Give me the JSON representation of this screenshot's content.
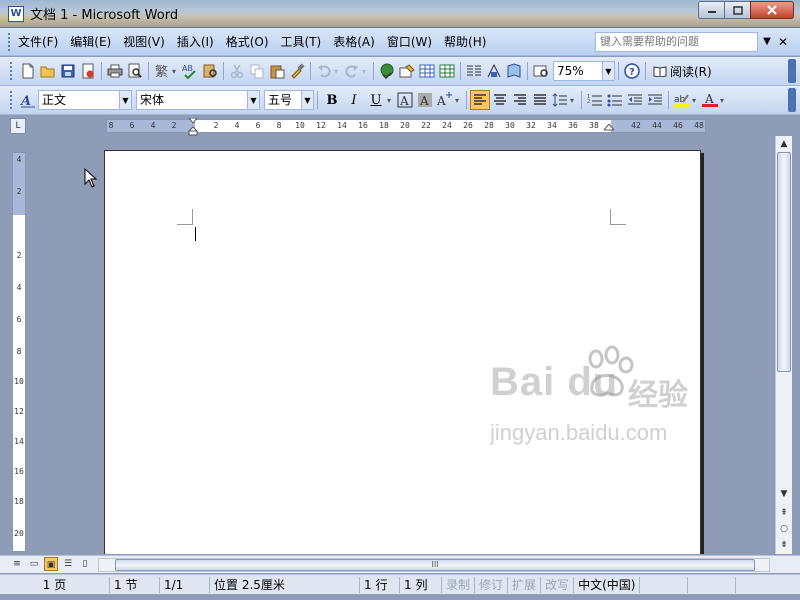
{
  "window": {
    "title": "文档 1 - Microsoft Word",
    "app_icon": "W",
    "min_icon": "minimize-icon",
    "max_icon": "maximize-icon",
    "close_icon": "close-icon"
  },
  "menubar": {
    "items": [
      {
        "label": "文件(F)"
      },
      {
        "label": "编辑(E)"
      },
      {
        "label": "视图(V)"
      },
      {
        "label": "插入(I)"
      },
      {
        "label": "格式(O)"
      },
      {
        "label": "工具(T)"
      },
      {
        "label": "表格(A)"
      },
      {
        "label": "窗口(W)"
      },
      {
        "label": "帮助(H)"
      }
    ],
    "help_placeholder": "键入需要帮助的问题"
  },
  "standard_toolbar": {
    "zoom": "75%",
    "read_label": "阅读(R)"
  },
  "format_toolbar": {
    "style": "正文",
    "font": "宋体",
    "size": "五号",
    "bold": "B",
    "italic": "I",
    "underline": "U"
  },
  "ruler": {
    "corner": "L",
    "h_ticks": [
      "8",
      "6",
      "4",
      "2",
      "2",
      "4",
      "6",
      "8",
      "10",
      "12",
      "14",
      "16",
      "18",
      "20",
      "22",
      "24",
      "26",
      "28",
      "30",
      "32",
      "34",
      "36",
      "38",
      "42",
      "44",
      "46",
      "48"
    ],
    "v_ticks": [
      "4",
      "2",
      "2",
      "4",
      "6",
      "8",
      "10",
      "12",
      "14",
      "16",
      "18",
      "20"
    ]
  },
  "watermark": {
    "logo": "Bai du",
    "cn": "经验",
    "url": "jingyan.baidu.com"
  },
  "hscroll": {
    "thumb_grip": "III"
  },
  "statusbar": {
    "page": "1 页",
    "section": "1 节",
    "page_of": "1/1",
    "position": "位置 2.5厘米",
    "line": "1 行",
    "col": "1 列",
    "rec": "录制",
    "trk": "修订",
    "ext": "扩展",
    "ovr": "改写",
    "lang": "中文(中国)"
  }
}
